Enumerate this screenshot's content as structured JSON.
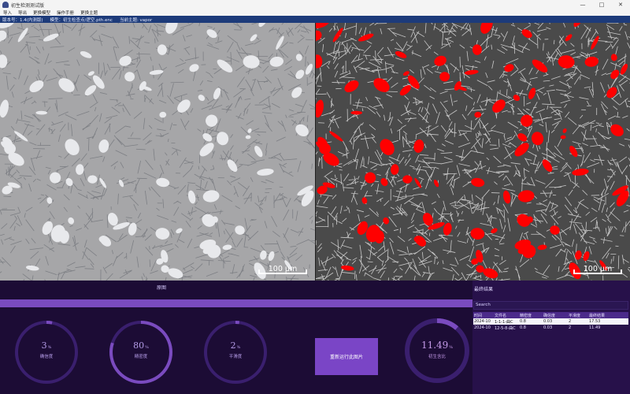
{
  "window": {
    "title": "初生检测测试版",
    "controls": {
      "minimize": "—",
      "maximize": "□",
      "close": "✕"
    }
  },
  "menu": [
    "导入",
    "导出",
    "更换模型",
    "操作手册",
    "更换主题"
  ],
  "status": {
    "version": "版本号：1.4(内测版)",
    "model": "模型：初生检查点/逻空.pth.enc",
    "theme": "当前主题: vapor"
  },
  "images": {
    "left_scale": "100 μm",
    "right_scale": "100 μm"
  },
  "dashboard": {
    "section_title": "原图",
    "gauges": [
      {
        "value": "3",
        "unit": "%",
        "label": "确信度",
        "fraction": 0.03
      },
      {
        "value": "80",
        "unit": "%",
        "label": "精密度",
        "fraction": 0.8
      },
      {
        "value": "2",
        "unit": "%",
        "label": "平滑度",
        "fraction": 0.02
      }
    ],
    "rerun_button": "重新运行此图片",
    "result_gauge": {
      "value": "11.49",
      "unit": "%",
      "label": "初生含比",
      "fraction": 0.1149
    }
  },
  "results": {
    "title": "最终结果",
    "search_placeholder": "Search",
    "columns": [
      "时间",
      "文件名",
      "精密度",
      "确信度",
      "平滑度",
      "最终结果"
    ],
    "rows": [
      [
        "2024-10",
        "1-1-1-曲C",
        "0.8",
        "0.03",
        "2",
        "17.53"
      ],
      [
        "2024-10",
        "12-5-8-曲C",
        "0.8",
        "0.03",
        "2",
        "11.49"
      ]
    ]
  },
  "colors": {
    "background": "#1b0c33",
    "accent": "#7a45c6",
    "gauge_track": "#3a1f6e",
    "gauge_fill": "#7a4bbf",
    "detection": "#ff0000",
    "status_bar": "#1d3b7a"
  }
}
